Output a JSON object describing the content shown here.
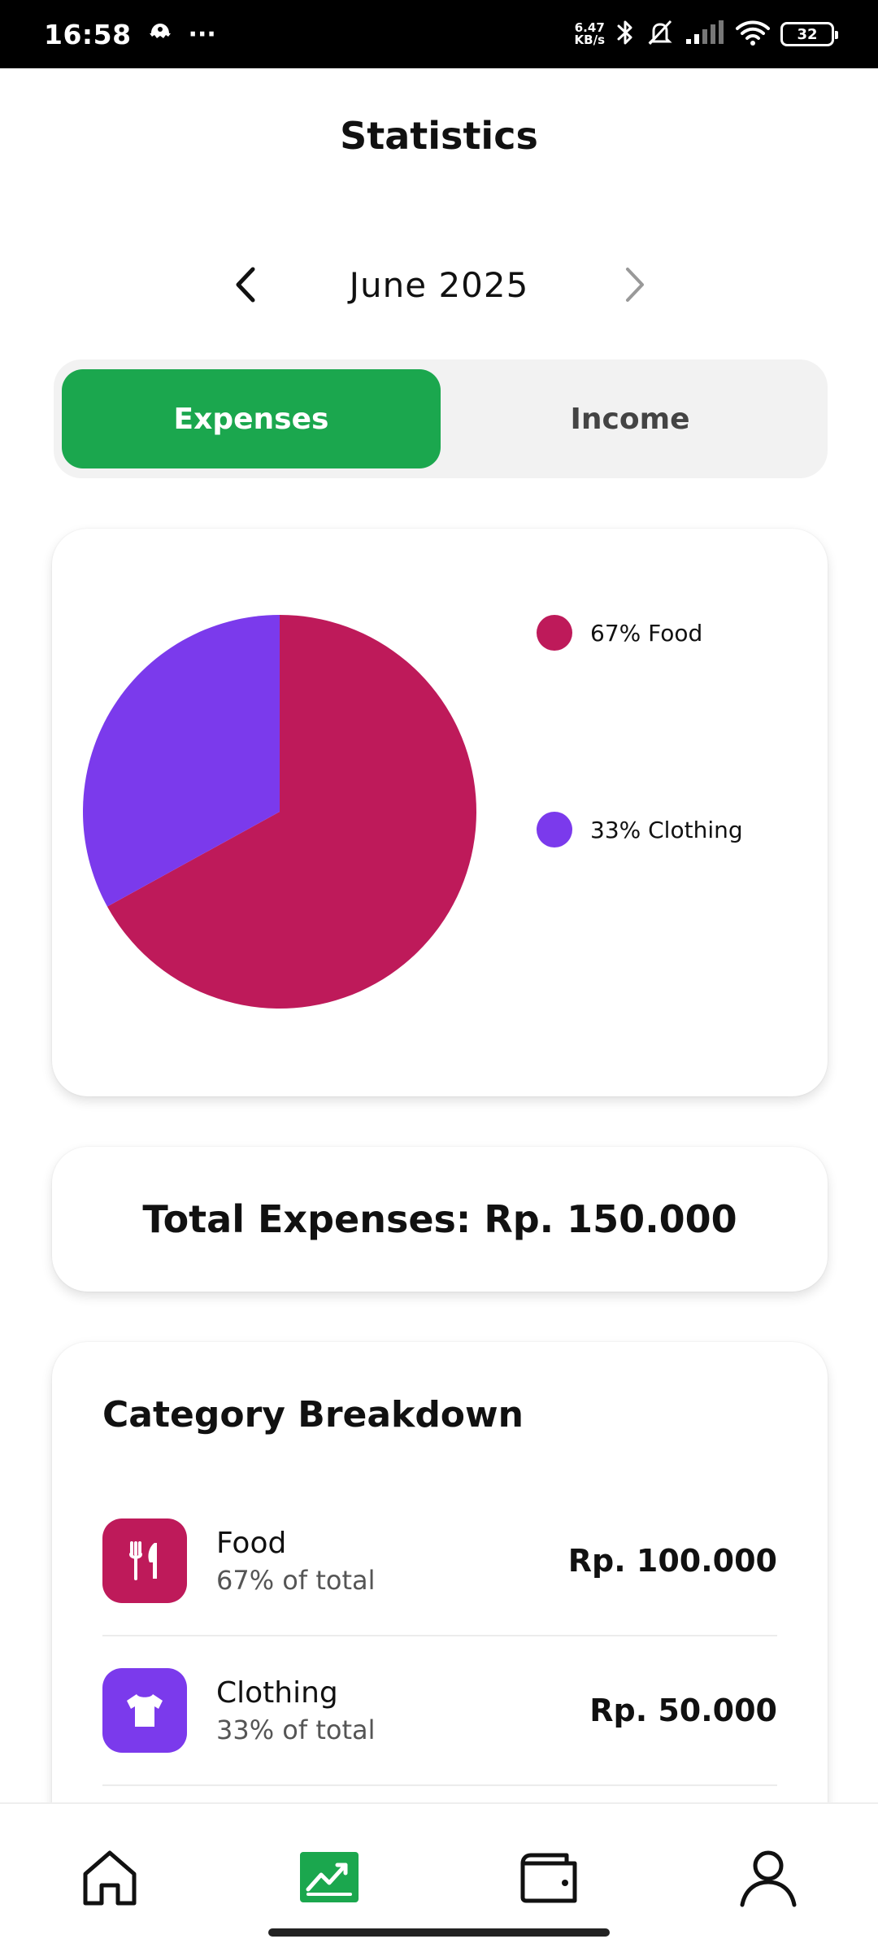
{
  "status_bar": {
    "time": "16:58",
    "more": "···",
    "net_speed_value": "6.47",
    "net_speed_unit": "KB/s",
    "battery": "32"
  },
  "header": {
    "title": "Statistics",
    "month": "June 2025"
  },
  "toggle": {
    "expenses_label": "Expenses",
    "income_label": "Income",
    "active": "Expenses"
  },
  "chart_data": {
    "type": "pie",
    "categories": [
      "Food",
      "Clothing"
    ],
    "values": [
      67,
      33
    ],
    "colors": [
      "#be1a5a",
      "#7b3aec"
    ],
    "legend": [
      "67% Food",
      "33% Clothing"
    ],
    "legend_position": "right"
  },
  "total": {
    "text": "Total Expenses: Rp. 150.000"
  },
  "breakdown": {
    "title": "Category Breakdown",
    "items": [
      {
        "name": "Food",
        "percent_text": "67% of total",
        "amount": "Rp. 100.000",
        "icon": "utensils-icon",
        "color": "#be1a5a"
      },
      {
        "name": "Clothing",
        "percent_text": "33% of total",
        "amount": "Rp. 50.000",
        "icon": "shirt-icon",
        "color": "#7b3aec"
      }
    ]
  },
  "nav": {
    "active": "statistics",
    "accent": "#1ba74e",
    "items": [
      "home-icon",
      "chart-icon",
      "wallet-icon",
      "profile-icon"
    ]
  }
}
